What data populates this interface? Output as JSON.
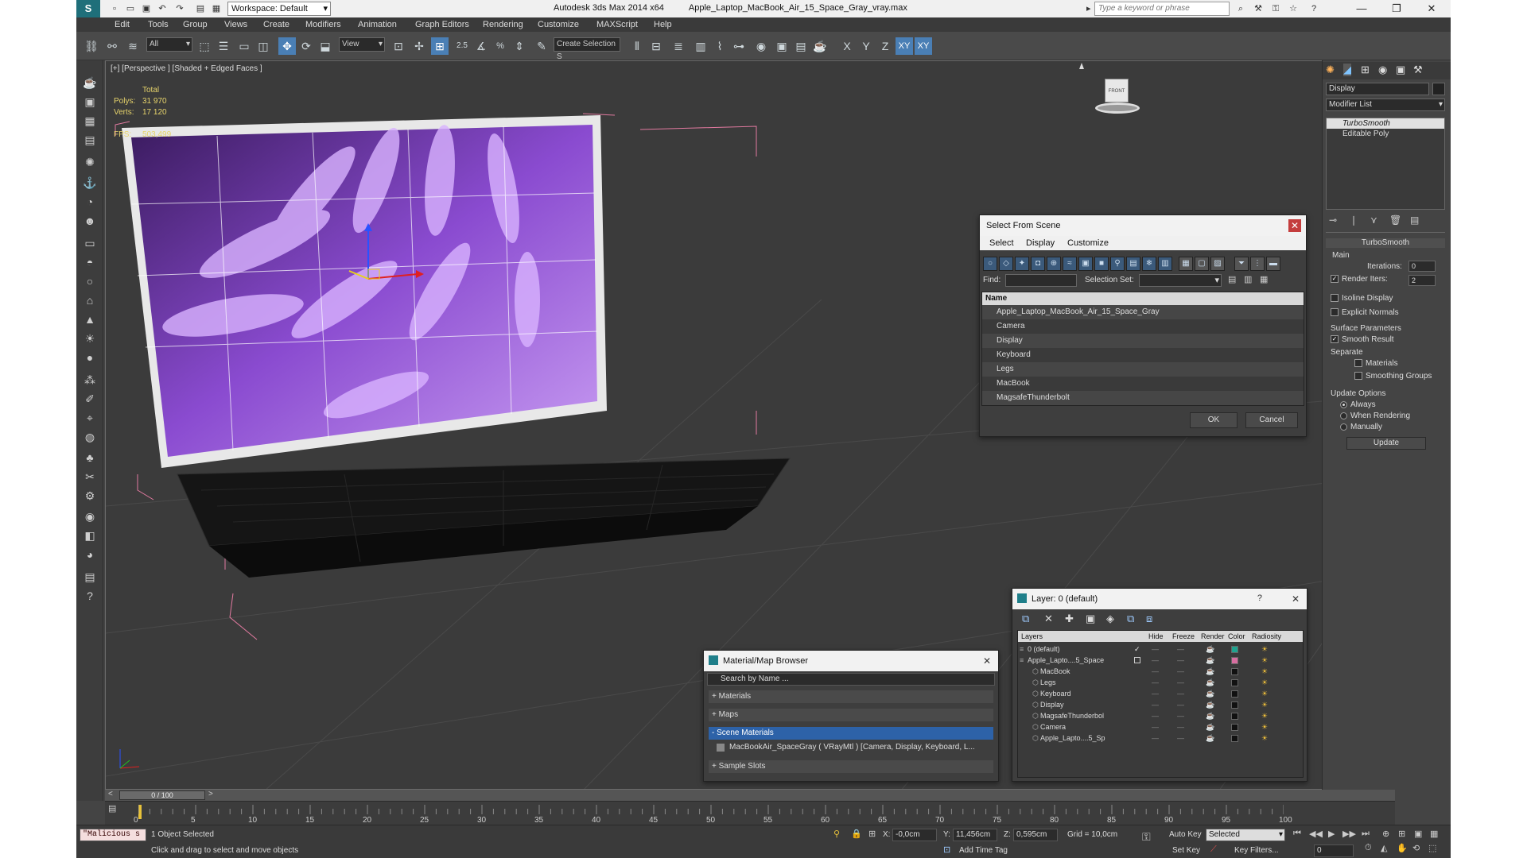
{
  "titlebar": {
    "workspace": "Workspace: Default",
    "app_title": "Autodesk 3ds Max  2014 x64",
    "file_name": "Apple_Laptop_MacBook_Air_15_Space_Gray_vray.max",
    "search_placeholder": "Type a keyword or phrase"
  },
  "menu": [
    "Edit",
    "Tools",
    "Group",
    "Views",
    "Create",
    "Modifiers",
    "Animation",
    "Graph Editors",
    "Rendering",
    "Customize",
    "MAXScript",
    "Help"
  ],
  "toolbar": {
    "selection_filter": "All",
    "ref_coord": "View",
    "named_selection": "Create Selection S",
    "snap_value": "2.5",
    "axis_labels": [
      "X",
      "Y",
      "Z",
      "XY",
      "XY"
    ]
  },
  "viewport": {
    "label": "[+] [Perspective ] [Shaded + Edged Faces ]",
    "stats": {
      "total_label": "Total",
      "polys_label": "Polys:",
      "polys": "31 970",
      "verts_label": "Verts:",
      "verts": "17 120",
      "fps_label": "FPS:",
      "fps": "503,499"
    },
    "viewcube_label": "FRONT"
  },
  "select_from_scene": {
    "title": "Select From Scene",
    "menus": [
      "Select",
      "Display",
      "Customize"
    ],
    "find_label": "Find:",
    "selection_set_label": "Selection Set:",
    "column_name": "Name",
    "items": [
      "Apple_Laptop_MacBook_Air_15_Space_Gray",
      "Camera",
      "Display",
      "Keyboard",
      "Legs",
      "MacBook",
      "MagsafeThunderbolt"
    ],
    "ok": "OK",
    "cancel": "Cancel"
  },
  "material_browser": {
    "title": "Material/Map Browser",
    "search": "Search by Name ...",
    "sections": {
      "materials": "+ Materials",
      "maps": "+ Maps",
      "scene_materials": "- Scene Materials",
      "scene_material_item": "MacBookAir_SpaceGray  ( VRayMtl )  [Camera, Display, Keyboard, L...",
      "sample_slots": "+ Sample Slots"
    }
  },
  "layer_dialog": {
    "title": "Layer: 0 (default)",
    "help": "?",
    "columns": [
      "Layers",
      "Hide",
      "Freeze",
      "Render",
      "Color",
      "Radiosity"
    ],
    "rows": [
      {
        "name": "0 (default)",
        "color": "#1fa38f"
      },
      {
        "name": "Apple_Lapto....5_Space",
        "color": "#d86ea0"
      },
      {
        "name": "MacBook",
        "color": "#111111"
      },
      {
        "name": "Legs",
        "color": "#111111"
      },
      {
        "name": "Keyboard",
        "color": "#111111"
      },
      {
        "name": "Display",
        "color": "#111111"
      },
      {
        "name": "MagsafeThunderbol",
        "color": "#111111"
      },
      {
        "name": "Camera",
        "color": "#111111"
      },
      {
        "name": "Apple_Lapto....5_Sp",
        "color": "#111111"
      }
    ]
  },
  "command_panel": {
    "object_name": "Display",
    "modifier_list": "Modifier List",
    "stack": [
      "TurboSmooth",
      "Editable Poly"
    ],
    "rollout_title": "TurboSmooth",
    "main_group": "Main",
    "iterations_label": "Iterations:",
    "iterations": "0",
    "render_iters_label": "Render Iters:",
    "render_iters": "2",
    "isoline": "Isoline Display",
    "explicit_normals": "Explicit Normals",
    "surface_params": "Surface Parameters",
    "smooth_result": "Smooth Result",
    "separate": "Separate",
    "materials": "Materials",
    "smoothing_groups": "Smoothing Groups",
    "update_options": "Update Options",
    "always": "Always",
    "when_rendering": "When Rendering",
    "manually": "Manually",
    "update_button": "Update"
  },
  "timeline": {
    "frame_counter": "0 / 100",
    "ticks": [
      "0",
      "5",
      "10",
      "15",
      "20",
      "25",
      "30",
      "35",
      "40",
      "45",
      "50",
      "55",
      "60",
      "65",
      "70",
      "75",
      "80",
      "85",
      "90",
      "95",
      "100"
    ]
  },
  "status": {
    "script_listener": "\"Malicious s",
    "selected": "1 Object Selected",
    "prompt": "Click and drag to select and move objects",
    "x_label": "X:",
    "x_value": "-0,0cm",
    "y_label": "Y:",
    "y_value": "11,456cm",
    "z_label": "Z:",
    "z_value": "0,595cm",
    "grid": "Grid = 10,0cm",
    "auto_key": "Auto Key",
    "auto_key_sel": "Selected",
    "set_key": "Set Key",
    "key_filters": "Key Filters...",
    "add_time_tag": "Add Time Tag",
    "frame": "0"
  }
}
